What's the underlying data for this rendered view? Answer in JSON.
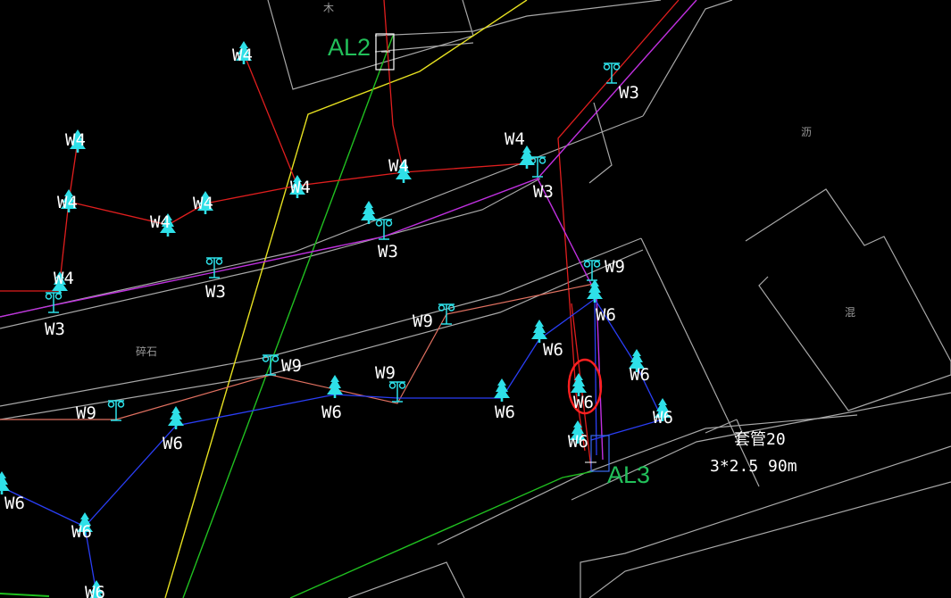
{
  "colors": {
    "background": "#000000",
    "building_outline": "#a8a8a8",
    "route_red": "#e01e1e",
    "route_magenta": "#c030e0",
    "route_blue": "#2a3ef5",
    "route_salmon": "#e07060",
    "road_yellow": "#e6e020",
    "road_green": "#20c020",
    "fixture_cyan": "#2ee0e8",
    "label_white": "#ffffff",
    "panel_label_green": "#22c05a",
    "highlight_circle": "#ff2020"
  },
  "panels": {
    "al2": "AL2",
    "al3": "AL3"
  },
  "cable_note": {
    "line1": "套管20",
    "line2": "3*2.5  90m"
  },
  "area_labels": [
    "木",
    "碎石",
    "沥",
    "混"
  ],
  "fixtures": [
    {
      "id": "w4-a",
      "icon": "tree-icon",
      "label": "W4"
    },
    {
      "id": "w4-b",
      "icon": "tree-icon",
      "label": "W4"
    },
    {
      "id": "w4-c",
      "icon": "tree-icon",
      "label": "W4"
    },
    {
      "id": "w4-d",
      "icon": "tree-icon",
      "label": "W4"
    },
    {
      "id": "w4-e",
      "icon": "tree-icon",
      "label": "W4"
    },
    {
      "id": "w4-f",
      "icon": "tree-icon",
      "label": "W4"
    },
    {
      "id": "w4-g",
      "icon": "tree-icon",
      "label": "W4"
    },
    {
      "id": "w4-h",
      "icon": "tree-icon",
      "label": "W4"
    },
    {
      "id": "w4-i",
      "icon": "tree-icon",
      "label": "W4"
    },
    {
      "id": "w3-a",
      "icon": "lamp-post-icon",
      "label": "W3"
    },
    {
      "id": "w3-b",
      "icon": "lamp-post-icon",
      "label": "W3"
    },
    {
      "id": "w3-c",
      "icon": "lamp-post-icon",
      "label": "W3"
    },
    {
      "id": "w3-d",
      "icon": "lamp-post-icon",
      "label": "W3"
    },
    {
      "id": "w3-e",
      "icon": "lamp-post-icon",
      "label": "W3"
    },
    {
      "id": "w9-a",
      "icon": "lamp-post-icon",
      "label": "W9"
    },
    {
      "id": "w9-b",
      "icon": "lamp-post-icon",
      "label": "W9"
    },
    {
      "id": "w9-c",
      "icon": "lamp-post-icon",
      "label": "W9"
    },
    {
      "id": "w9-d",
      "icon": "lamp-post-icon",
      "label": "W9"
    },
    {
      "id": "w9-e",
      "icon": "lamp-post-icon",
      "label": "W9"
    },
    {
      "id": "w6-a",
      "icon": "tree-icon",
      "label": "W6"
    },
    {
      "id": "w6-b",
      "icon": "tree-icon",
      "label": "W6"
    },
    {
      "id": "w6-c",
      "icon": "tree-icon",
      "label": "W6"
    },
    {
      "id": "w6-d",
      "icon": "tree-icon",
      "label": "W6"
    },
    {
      "id": "w6-e",
      "icon": "tree-icon",
      "label": "W6"
    },
    {
      "id": "w6-f",
      "icon": "tree-icon",
      "label": "W6"
    },
    {
      "id": "w6-g",
      "icon": "tree-icon",
      "label": "W6"
    },
    {
      "id": "w6-h",
      "icon": "tree-icon",
      "label": "W6"
    },
    {
      "id": "w6-i",
      "icon": "tree-icon",
      "label": "W6"
    },
    {
      "id": "w6-j",
      "icon": "tree-icon",
      "label": "W6"
    },
    {
      "id": "w6-k",
      "icon": "tree-icon",
      "label": "W6"
    },
    {
      "id": "w6-l",
      "icon": "tree-icon",
      "label": "W6"
    },
    {
      "id": "w6-m",
      "icon": "tree-icon",
      "label": "W6"
    }
  ]
}
